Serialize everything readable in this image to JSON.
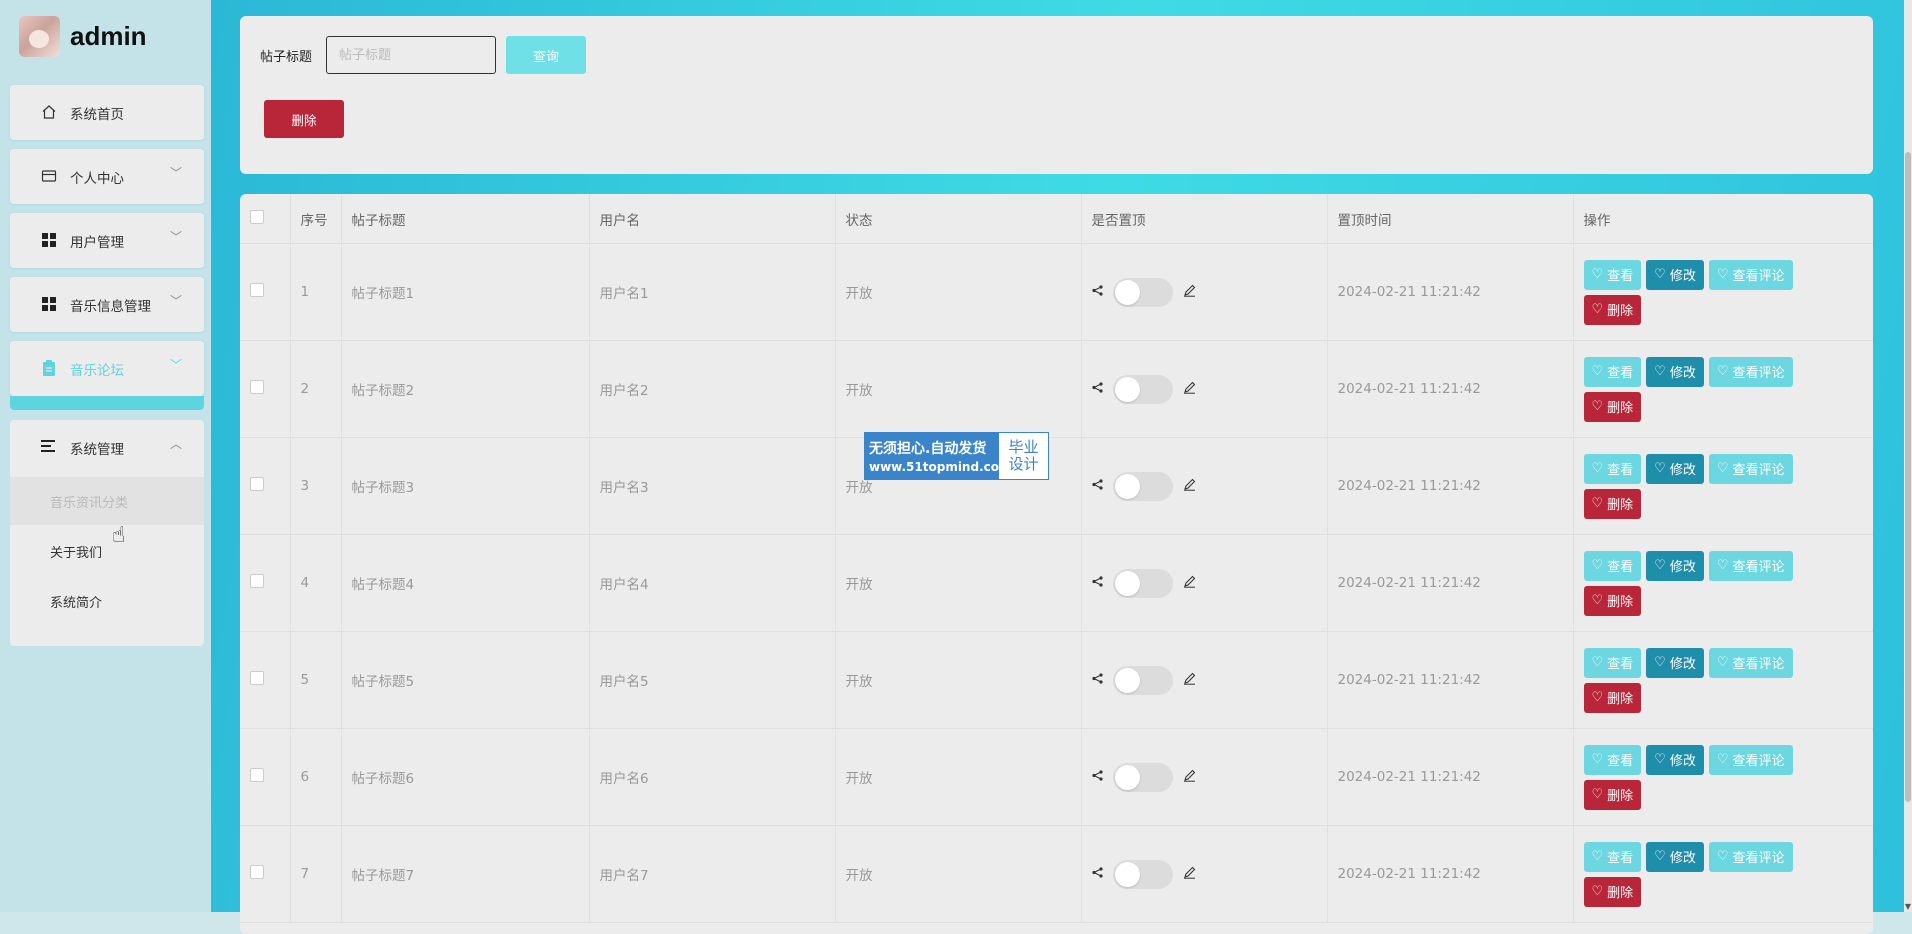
{
  "brand": {
    "name": "admin"
  },
  "sidebar": {
    "items": [
      {
        "label": "系统首页",
        "icon": "home-icon"
      },
      {
        "label": "个人中心",
        "icon": "card-icon"
      },
      {
        "label": "用户管理",
        "icon": "grid-icon"
      },
      {
        "label": "音乐信息管理",
        "icon": "grid-icon"
      },
      {
        "label": "音乐论坛",
        "icon": "clipboard-icon",
        "active": true
      },
      {
        "label": "系统管理",
        "icon": "list-icon",
        "expanded": true
      }
    ],
    "submenu": [
      {
        "label": "音乐资讯分类"
      },
      {
        "label": "关于我们"
      },
      {
        "label": "系统简介"
      }
    ]
  },
  "search": {
    "label": "帖子标题",
    "placeholder": "帖子标题",
    "query_label": "查询",
    "delete_label": "删除"
  },
  "table": {
    "columns": [
      "序号",
      "帖子标题",
      "用户名",
      "状态",
      "是否置顶",
      "置顶时间",
      "操作"
    ],
    "rows": [
      {
        "index": "1",
        "title": "帖子标题1",
        "user": "用户名1",
        "status": "开放",
        "time": "2024-02-21 11:21:42"
      },
      {
        "index": "2",
        "title": "帖子标题2",
        "user": "用户名2",
        "status": "开放",
        "time": "2024-02-21 11:21:42"
      },
      {
        "index": "3",
        "title": "帖子标题3",
        "user": "用户名3",
        "status": "开放",
        "time": "2024-02-21 11:21:42"
      },
      {
        "index": "4",
        "title": "帖子标题4",
        "user": "用户名4",
        "status": "开放",
        "time": "2024-02-21 11:21:42"
      },
      {
        "index": "5",
        "title": "帖子标题5",
        "user": "用户名5",
        "status": "开放",
        "time": "2024-02-21 11:21:42"
      },
      {
        "index": "6",
        "title": "帖子标题6",
        "user": "用户名6",
        "status": "开放",
        "time": "2024-02-21 11:21:42"
      },
      {
        "index": "7",
        "title": "帖子标题7",
        "user": "用户名7",
        "status": "开放",
        "time": "2024-02-21 11:21:42"
      }
    ],
    "actions": {
      "view": "查看",
      "edit": "修改",
      "comments": "查看评论",
      "delete": "删除"
    }
  },
  "watermark": {
    "line1": "无须担心.自动发货",
    "line2": "www.51topmind.com",
    "right1": "毕业",
    "right2": "设计"
  },
  "colors": {
    "accent": "#5fd3df",
    "danger": "#b92539",
    "edit": "#1f8eab"
  }
}
